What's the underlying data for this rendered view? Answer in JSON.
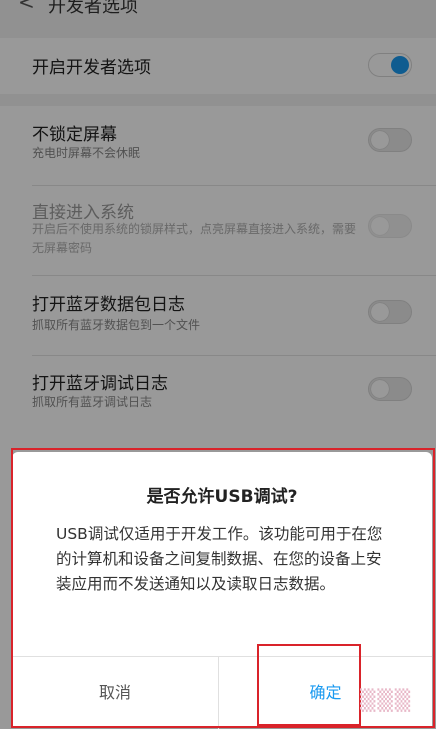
{
  "header": {
    "back_glyph": "<",
    "title": "开发者选项"
  },
  "settings": {
    "enable_dev": {
      "label": "开启开发者选项",
      "on": true
    },
    "stay_awake": {
      "label": "不锁定屏幕",
      "desc": "充电时屏幕不会休眠",
      "on": false
    },
    "direct_boot": {
      "label": "直接进入系统",
      "desc": "开启后不使用系统的锁屏样式，点亮屏幕直接进入系统，需要无屏幕密码",
      "on": false,
      "disabled": true
    },
    "bt_hci_log": {
      "label": "打开蓝牙数据包日志",
      "desc": "抓取所有蓝牙数据包到一个文件",
      "on": false
    },
    "bt_debug_log": {
      "label": "打开蓝牙调试日志",
      "desc": "抓取所有蓝牙调试日志",
      "on": false
    }
  },
  "dialog": {
    "title": "是否允许USB调试?",
    "message": "USB调试仅适用于开发工作。该功能可用于在您的计算机和设备之间复制数据、在您的设备上安装应用而不发送通知以及读取日志数据。",
    "cancel_label": "取消",
    "ok_label": "确定"
  },
  "colors": {
    "accent": "#1a9af0",
    "highlight": "#d9232a"
  }
}
